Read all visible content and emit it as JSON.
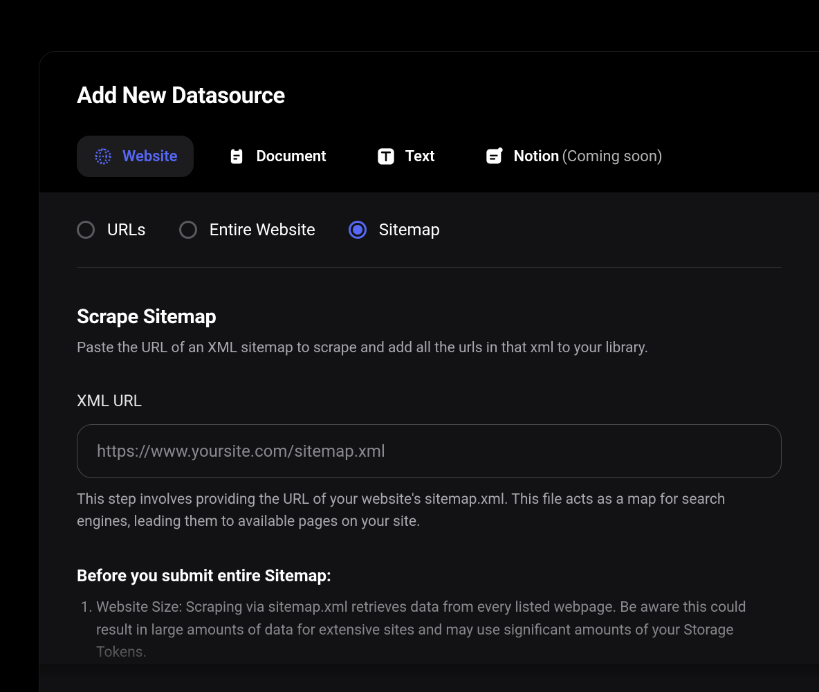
{
  "header": {
    "title": "Add New Datasource"
  },
  "tabs": [
    {
      "label": "Website",
      "icon": "globe-icon",
      "active": true
    },
    {
      "label": "Document",
      "icon": "clipboard-icon",
      "active": false
    },
    {
      "label": "Text",
      "icon": "text-icon",
      "active": false
    },
    {
      "label": "Notion",
      "icon": "notion-icon",
      "suffix": "(Coming soon)",
      "active": false
    }
  ],
  "radios": [
    {
      "label": "URLs",
      "selected": false
    },
    {
      "label": "Entire Website",
      "selected": false
    },
    {
      "label": "Sitemap",
      "selected": true
    }
  ],
  "section": {
    "title": "Scrape Sitemap",
    "description": "Paste the URL of an XML sitemap to scrape and add all the urls in that xml to your library."
  },
  "field": {
    "label": "XML URL",
    "placeholder": "https://www.yoursite.com/sitemap.xml",
    "value": "",
    "help": "This step involves providing the URL of your website's sitemap.xml. This file acts as a map for search engines, leading them to available pages on your site."
  },
  "warning": {
    "title": "Before you submit entire Sitemap:",
    "items": [
      "Website Size: Scraping via sitemap.xml retrieves data from every listed webpage. Be aware this could result in large amounts of data for extensive sites and may use significant amounts of your Storage Tokens."
    ]
  },
  "colors": {
    "accent": "#5568f7",
    "background": "#000000",
    "panel": "#121214"
  }
}
